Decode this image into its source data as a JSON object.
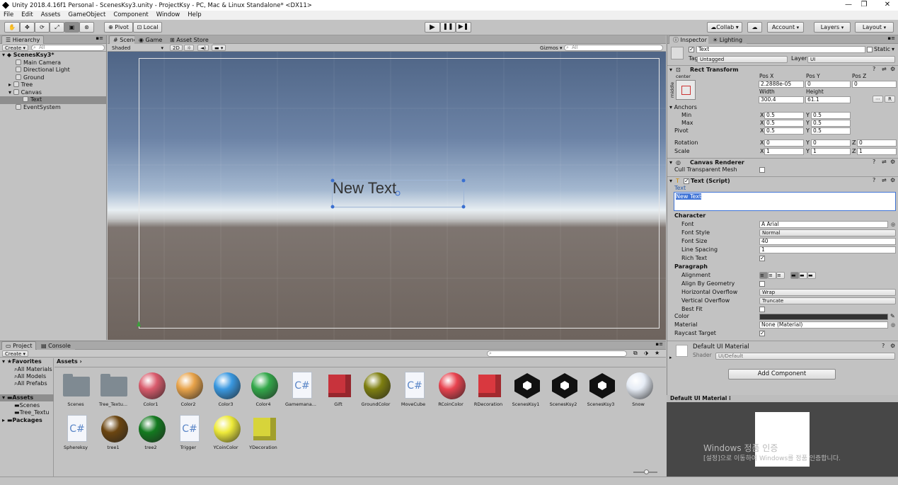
{
  "window": {
    "title": "Unity 2018.4.16f1 Personal - ScenesKsy3.unity - ProjectKsy - PC, Mac & Linux Standalone* <DX11>"
  },
  "menu": [
    "File",
    "Edit",
    "Assets",
    "GameObject",
    "Component",
    "Window",
    "Help"
  ],
  "toolbar": {
    "pivot": "Pivot",
    "local": "Local",
    "collab": "Collab ▾",
    "account": "Account",
    "layers": "Layers",
    "layout": "Layout"
  },
  "hierarchy": {
    "tab": "Hierarchy",
    "create": "Create",
    "search_placeholder": "All",
    "scene": "ScenesKsy3*",
    "items": [
      "Main Camera",
      "Directional Light",
      "Ground",
      "Tree",
      "Canvas",
      "Text",
      "EventSystem"
    ]
  },
  "scene_view": {
    "tabs": [
      "Scene",
      "Game",
      "Asset Store"
    ],
    "shading": "Shaded",
    "mode_2d": "2D",
    "gizmos": "Gizmos",
    "search_placeholder": "All",
    "text_object": "New Text"
  },
  "project": {
    "tabs": [
      "Project",
      "Console"
    ],
    "create": "Create",
    "favorites": {
      "label": "Favorites",
      "items": [
        "All Materials",
        "All Models",
        "All Prefabs"
      ]
    },
    "assets_tree": {
      "label": "Assets",
      "items": [
        "Scenes",
        "Tree_Textu"
      ]
    },
    "packages": "Packages",
    "breadcrumb": "Assets",
    "assets": [
      {
        "name": "Scenes",
        "kind": "folder"
      },
      {
        "name": "Tree_Textu...",
        "kind": "folder"
      },
      {
        "name": "Color1",
        "kind": "sphere",
        "color": "#d95b6c"
      },
      {
        "name": "Color2",
        "kind": "sphere",
        "color": "#e8a34a"
      },
      {
        "name": "Color3",
        "kind": "sphere",
        "color": "#3a98e0"
      },
      {
        "name": "Color4",
        "kind": "sphere",
        "color": "#33a84a"
      },
      {
        "name": "Gamemana...",
        "kind": "script"
      },
      {
        "name": "Gift",
        "kind": "cube",
        "color": "#c8333c"
      },
      {
        "name": "GroundColor",
        "kind": "sphere",
        "color": "#7e7f10"
      },
      {
        "name": "MoveCube",
        "kind": "script"
      },
      {
        "name": "RCoinColor",
        "kind": "sphere",
        "color": "#e8434f"
      },
      {
        "name": "RDecoration",
        "kind": "cube",
        "color": "#d9383f"
      },
      {
        "name": "ScenesKsy1",
        "kind": "unity"
      },
      {
        "name": "ScenesKsy2",
        "kind": "unity"
      },
      {
        "name": "ScenesKsy3",
        "kind": "unity"
      },
      {
        "name": "Snow",
        "kind": "sphere",
        "color": "#e6ecf5"
      },
      {
        "name": "Sphereksy",
        "kind": "script"
      },
      {
        "name": "tree1",
        "kind": "sphere",
        "color": "#6b4510"
      },
      {
        "name": "tree2",
        "kind": "sphere",
        "color": "#137a1f"
      },
      {
        "name": "Trigger",
        "kind": "script"
      },
      {
        "name": "YCoinColor",
        "kind": "sphere",
        "color": "#eeea3a"
      },
      {
        "name": "YDecoration",
        "kind": "cube",
        "color": "#d7d43a"
      }
    ]
  },
  "inspector": {
    "tabs": [
      "Inspector",
      "Lighting"
    ],
    "object_name": "Text",
    "static": "Static",
    "tag_label": "Tag",
    "tag": "Untagged",
    "layer_label": "Layer",
    "layer": "UI",
    "rect": {
      "title": "Rect Transform",
      "anchor_preset": "center",
      "anchor_side": "middle",
      "posx_lbl": "Pos X",
      "posy_lbl": "Pos Y",
      "posz_lbl": "Pos Z",
      "posx": "2.2888e-05",
      "posy": "0",
      "posz": "0",
      "width_lbl": "Width",
      "height_lbl": "Height",
      "width": "300.4",
      "height": "61.1",
      "r": "R",
      "anchors": "Anchors",
      "min": "Min",
      "max": "Max",
      "pivot": "Pivot",
      "rotation": "Rotation",
      "scale": "Scale",
      "x": "X",
      "y": "Y",
      "z": "Z",
      "min_x": "0.5",
      "min_y": "0.5",
      "max_x": "0.5",
      "max_y": "0.5",
      "pivot_x": "0.5",
      "pivot_y": "0.5",
      "rot_x": "0",
      "rot_y": "0",
      "rot_z": "0",
      "scale_x": "1",
      "scale_y": "1",
      "scale_z": "1"
    },
    "canvas_renderer": {
      "title": "Canvas Renderer",
      "cull": "Cull Transparent Mesh"
    },
    "text_script": {
      "title": "Text (Script)",
      "text_label": "Text",
      "text_value": "New Text",
      "character": "Character",
      "font_lbl": "Font",
      "font": "Arial",
      "font_style_lbl": "Font Style",
      "font_style": "Normal",
      "font_size_lbl": "Font Size",
      "font_size": "40",
      "line_spacing_lbl": "Line Spacing",
      "line_spacing": "1",
      "rich_text_lbl": "Rich Text",
      "paragraph": "Paragraph",
      "alignment_lbl": "Alignment",
      "align_geom_lbl": "Align By Geometry",
      "hoverflow_lbl": "Horizontal Overflow",
      "hoverflow": "Wrap",
      "voverflow_lbl": "Vertical Overflow",
      "voverflow": "Truncate",
      "bestfit_lbl": "Best Fit",
      "color_lbl": "Color",
      "material_lbl": "Material",
      "material": "None (Material)",
      "raycast_lbl": "Raycast Target"
    },
    "material": {
      "name": "Default UI Material",
      "shader_lbl": "Shader",
      "shader": "UI/Default"
    },
    "add_component": "Add Component",
    "preview_title": "Default UI Material",
    "watermark1": "Windows 정품 인증",
    "watermark2": "[설정]으로 이동하여 Windows를 정품 인증합니다."
  }
}
